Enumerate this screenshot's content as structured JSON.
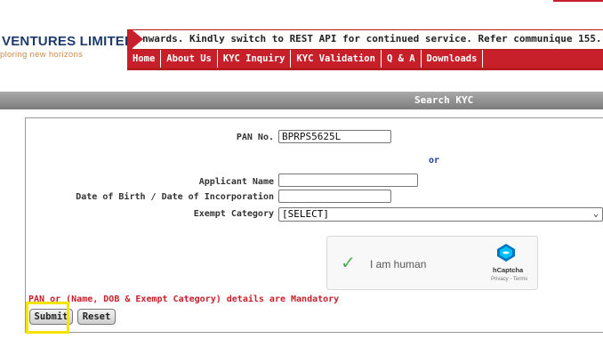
{
  "brand": {
    "title": "VENTURES LIMITED",
    "tagline": "ploring new horizons"
  },
  "ticker": {
    "text": "nwards. Kindly switch to REST API for continued service. Refer communique 155."
  },
  "nav": {
    "items": [
      "Home",
      "About Us",
      "KYC Inquiry",
      "KYC Validation",
      "Q & A",
      "Downloads"
    ]
  },
  "section": {
    "title": "Search KYC"
  },
  "form": {
    "pan_label": "PAN No.",
    "pan_value": "BPRPS5625L",
    "or_text": "or",
    "applicant_label": "Applicant Name",
    "applicant_value": "",
    "dob_label": "Date of Birth / Date of Incorporation",
    "dob_value": "",
    "exempt_label": "Exempt Category",
    "exempt_selected": "[SELECT]"
  },
  "captcha": {
    "label": "I am human",
    "brand": "hCaptcha",
    "links": "Privacy - Terms"
  },
  "messages": {
    "mandatory": "PAN or (Name, DOB & Exempt Category) details are Mandatory"
  },
  "buttons": {
    "submit": "Submit",
    "reset": "Reset"
  },
  "colors": {
    "accent": "#c8202a",
    "brand_blue": "#1f3b6e",
    "highlight": "#f5e400"
  }
}
